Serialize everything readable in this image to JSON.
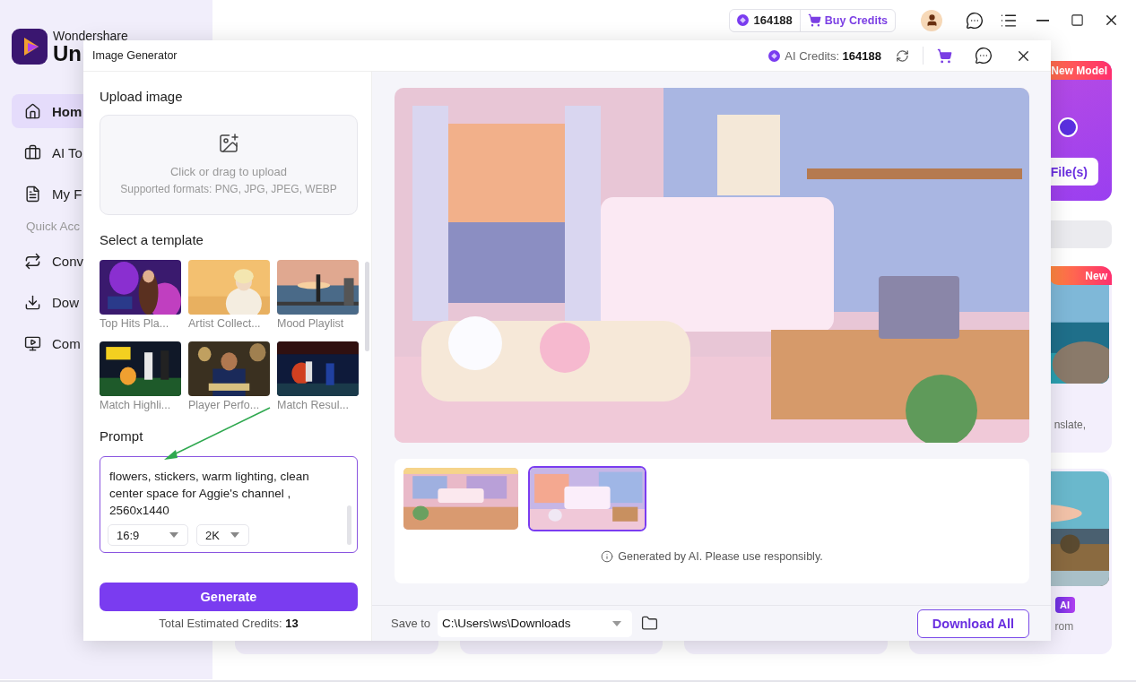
{
  "app": {
    "brand": {
      "company": "Wondershare",
      "product": "Un"
    },
    "sidebar": {
      "items": [
        {
          "label": "Hom",
          "selected": true
        },
        {
          "label": "AI To",
          "selected": false
        },
        {
          "label": "My F",
          "selected": false
        }
      ],
      "section_label": "Quick Acc",
      "quick_items": [
        {
          "label": "Conv"
        },
        {
          "label": "Dow"
        },
        {
          "label": "Com"
        }
      ]
    },
    "top_bar": {
      "credits": "164188",
      "buy_credits": "Buy Credits"
    },
    "cards": {
      "badge_new_model": "New Model",
      "file_button": "File(s)",
      "badge_new": "New",
      "card_2_text": "nslate,",
      "badge_ai": "AI",
      "card_3_text": "rom"
    }
  },
  "dialog": {
    "title": "Image Generator",
    "credits": "AI Credits: **164188**",
    "upload": {
      "title": "Upload image",
      "hint": "Click or drag to upload",
      "formats": "Supported formats: PNG, JPG, JPEG, WEBP"
    },
    "templates": {
      "title": "Select a template",
      "items": [
        {
          "caption": "Top Hits Pla..."
        },
        {
          "caption": "Artist Collect..."
        },
        {
          "caption": "Mood Playlist"
        },
        {
          "caption": "Match Highli..."
        },
        {
          "caption": "Player Perfo..."
        },
        {
          "caption": "Match Resul..."
        }
      ]
    },
    "prompt": {
      "title": "Prompt",
      "value": "flowers, stickers, warm lighting, clean center space for Aggie's channel , 2560x1440",
      "aspect": "16:9",
      "resolution": "2K"
    },
    "generate": "Generate",
    "estimate": "Total Estimated Credits: **13**",
    "results": [
      {
        "selected": false
      },
      {
        "selected": true
      }
    ],
    "disclaimer": "Generated by AI. Please use responsibly.",
    "save_label": "Save to",
    "save_path": "C:\\Users\\ws\\Downloads",
    "download_all": "Download All"
  }
}
